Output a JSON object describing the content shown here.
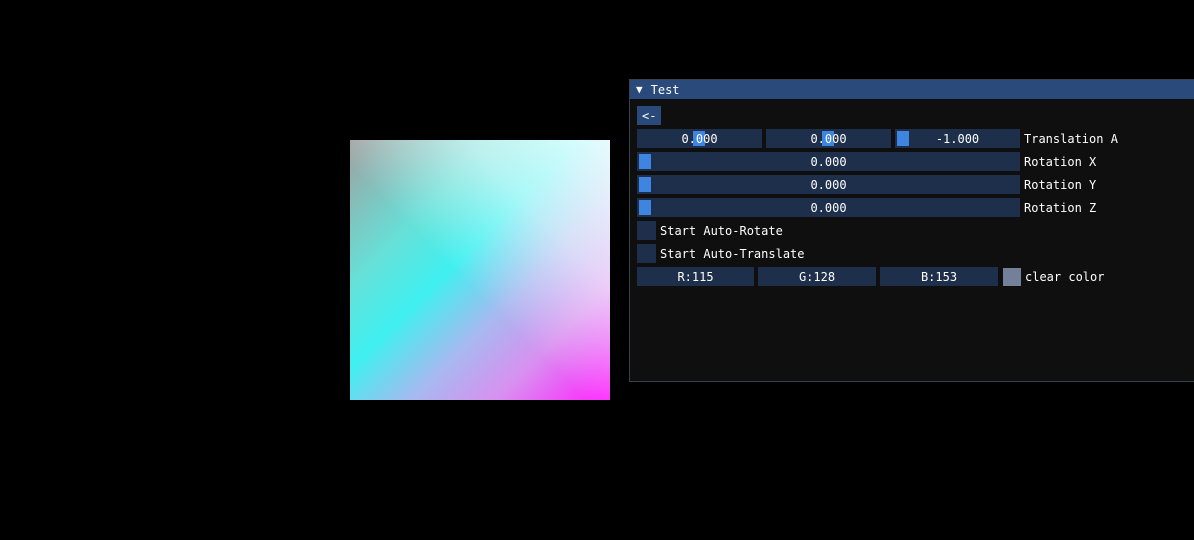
{
  "window": {
    "title": "Test",
    "collapse_icon": "triangle-down-icon",
    "back_button": "<-",
    "translation": {
      "values": [
        "0.000",
        "0.000",
        "-1.000"
      ],
      "label": "Translation A"
    },
    "rotation_x": {
      "value": "0.000",
      "label": "Rotation X"
    },
    "rotation_y": {
      "value": "0.000",
      "label": "Rotation Y"
    },
    "rotation_z": {
      "value": "0.000",
      "label": "Rotation Z"
    },
    "auto_rotate_label": "Start Auto-Rotate",
    "auto_translate_label": "Start Auto-Translate",
    "clear_color": {
      "r": "R:115",
      "g": "G:128",
      "b": "B:153",
      "label": "clear color",
      "swatch": "#738099"
    }
  },
  "colors": {
    "title_bar": "#294a7a",
    "frame_bg": "#1d2f4a",
    "slider_grab": "#3d85e0",
    "window_bg": "#0f0f0f"
  }
}
